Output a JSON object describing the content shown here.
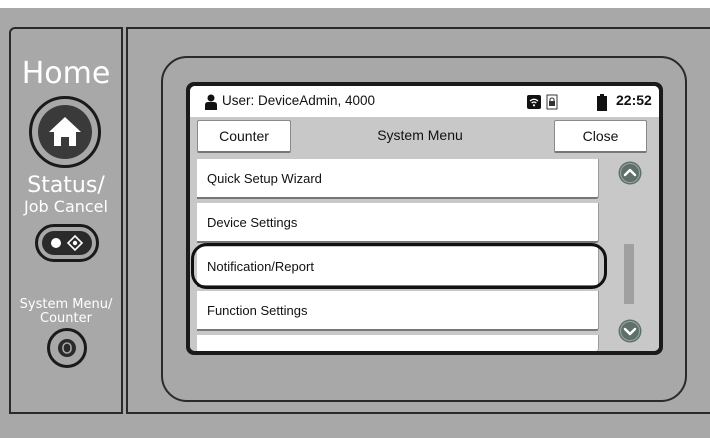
{
  "hardware": {
    "home_label": "Home",
    "status_label": "Status/",
    "job_cancel_label": "Job Cancel",
    "system_menu_label": "System Menu/",
    "counter_label": "Counter"
  },
  "statusbar": {
    "user_text": "User: DeviceAdmin, 4000",
    "clock": "22:52",
    "icons": [
      "user-icon",
      "wifi-icon",
      "lock-icon",
      "battery-icon"
    ]
  },
  "titlebar": {
    "counter_button": "Counter",
    "title": "System Menu",
    "close_button": "Close"
  },
  "menu": {
    "items": [
      {
        "label": "Quick Setup Wizard"
      },
      {
        "label": "Device Settings"
      },
      {
        "label": "Notification/Report",
        "highlighted": true
      },
      {
        "label": "Function Settings"
      },
      {
        "label": ""
      }
    ]
  },
  "colors": {
    "panel": "#a8a8a8",
    "screen_bg": "#c8c8c8",
    "scroll_button": "#5f6f6a",
    "highlight_ring": "#111111"
  }
}
